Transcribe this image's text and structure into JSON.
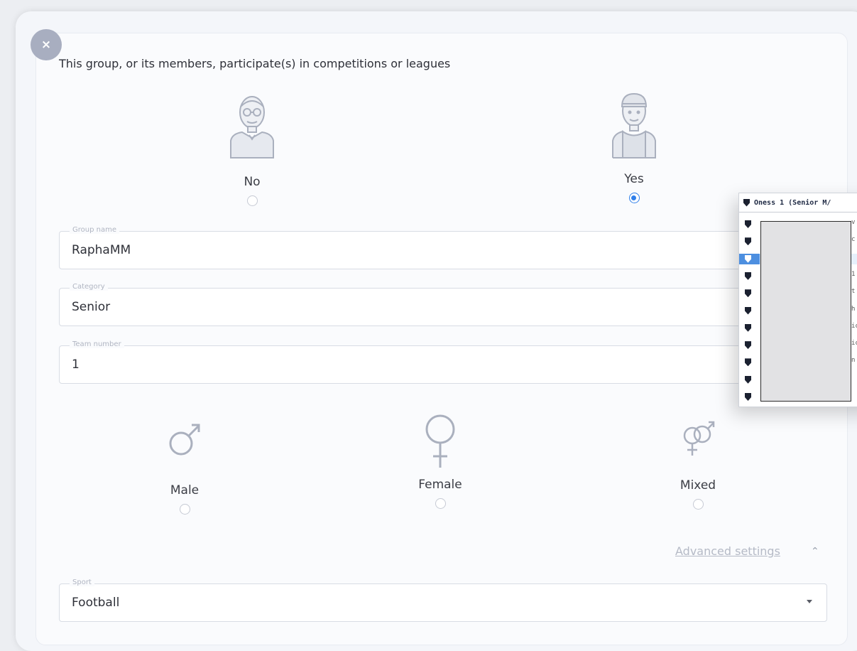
{
  "close_label": "×",
  "question": "This group, or its members, participate(s) in competitions or leagues",
  "participation": {
    "options": [
      {
        "label": "No",
        "icon": "person-glasses-icon",
        "selected": false
      },
      {
        "label": "Yes",
        "icon": "athlete-icon",
        "selected": true
      }
    ]
  },
  "fields": {
    "group_name": {
      "label": "Group name",
      "value": "RaphaMM"
    },
    "category": {
      "label": "Category",
      "value": "Senior"
    },
    "team_number": {
      "label": "Team number",
      "value": "1"
    }
  },
  "gender": {
    "options": [
      {
        "label": "Male",
        "icon": "male-symbol-icon",
        "selected": false
      },
      {
        "label": "Female",
        "icon": "female-symbol-icon",
        "selected": false
      },
      {
        "label": "Mixed",
        "icon": "mixed-gender-icon",
        "selected": false
      }
    ]
  },
  "advanced_settings": {
    "label": "Advanced settings",
    "expanded": true
  },
  "sport": {
    "label": "Sport",
    "value": "Football"
  },
  "popup": {
    "header": "Oness 1 (Senior M/",
    "selected_index": 2,
    "rows": [
      "v",
      "c",
      "",
      "1",
      "t",
      "h",
      "ic",
      "ic",
      "n",
      "",
      ""
    ]
  },
  "colors": {
    "accent": "#2f7fea",
    "icon_gray": "#aab0be",
    "close_bg": "#a8aec0"
  }
}
